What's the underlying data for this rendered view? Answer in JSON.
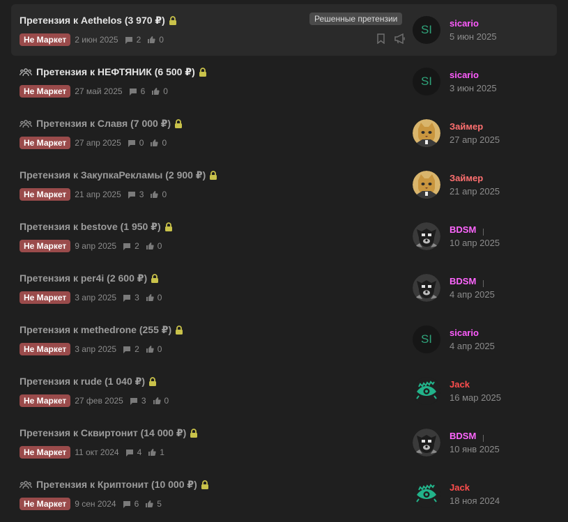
{
  "badge_label": "Не Маркет",
  "solved_tag": "Решенные претензии",
  "colors": {
    "badge": "#9a4b4b",
    "sicario": "#ff5cff",
    "zaimer": "#ff7070",
    "bdsm": "#ff66ff",
    "jack": "#ff4d4d",
    "lock": "#c9c24a"
  },
  "threads": [
    {
      "title": "Претензия к Aethelos (3 970 ₽)",
      "date": "2 июн 2025",
      "replies": "2",
      "likes": "0",
      "user": "sicario",
      "user_date": "5 июн 2025",
      "avatar": "SI",
      "group_icon": false
    },
    {
      "title": "Претензия к НЕФТЯНИК (6 500 ₽)",
      "date": "27 май 2025",
      "replies": "6",
      "likes": "0",
      "user": "sicario",
      "user_date": "3 июн 2025",
      "avatar": "SI",
      "group_icon": true
    },
    {
      "title": "Претензия к Славя (7 000 ₽)",
      "date": "27 апр 2025",
      "replies": "0",
      "likes": "0",
      "user": "Займер",
      "user_date": "27 апр 2025",
      "avatar": "cat-avatar",
      "group_icon": true
    },
    {
      "title": "Претензия к ЗакупкаРекламы (2 900 ₽)",
      "date": "21 апр 2025",
      "replies": "3",
      "likes": "0",
      "user": "Займер",
      "user_date": "21 апр 2025",
      "avatar": "cat-avatar",
      "group_icon": false
    },
    {
      "title": "Претензия к bestove (1 950 ₽)",
      "date": "9 апр 2025",
      "replies": "2",
      "likes": "0",
      "user": "BDSM",
      "user_date": "10 апр 2025",
      "avatar": "dog-avatar",
      "group_icon": false
    },
    {
      "title": "Претензия к per4i (2 600 ₽)",
      "date": "3 апр 2025",
      "replies": "3",
      "likes": "0",
      "user": "BDSM",
      "user_date": "4 апр 2025",
      "avatar": "dog-avatar",
      "group_icon": false
    },
    {
      "title": "Претензия к methedrone (255 ₽)",
      "date": "3 апр 2025",
      "replies": "2",
      "likes": "0",
      "user": "sicario",
      "user_date": "4 апр 2025",
      "avatar": "SI",
      "group_icon": false
    },
    {
      "title": "Претензия к rude (1 040 ₽)",
      "date": "27 фев 2025",
      "replies": "3",
      "likes": "0",
      "user": "Jack",
      "user_date": "16 мар 2025",
      "avatar": "eye-avatar",
      "group_icon": false
    },
    {
      "title": "Претензия к Сквиртонит (14 000 ₽)",
      "date": "11 окт 2024",
      "replies": "4",
      "likes": "1",
      "user": "BDSM",
      "user_date": "10 янв 2025",
      "avatar": "dog-avatar",
      "group_icon": false
    },
    {
      "title": "Претензия к Криптонит (10 000 ₽)",
      "date": "9 сен 2024",
      "replies": "6",
      "likes": "5",
      "user": "Jack",
      "user_date": "18 ноя 2024",
      "avatar": "eye-avatar",
      "group_icon": true
    }
  ]
}
